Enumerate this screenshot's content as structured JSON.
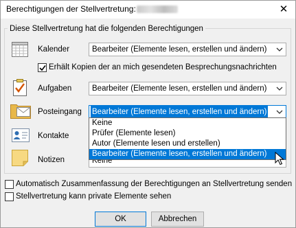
{
  "window": {
    "title": "Berechtigungen der Stellvertretung:",
    "close_glyph": "✕"
  },
  "group": {
    "caption": "Diese Stellvertretung hat die folgenden Berechtigungen"
  },
  "rows": {
    "kalender": {
      "label": "Kalender",
      "value": "Bearbeiter (Elemente lesen, erstellen und ändern)",
      "icon": "calendar-icon"
    },
    "aufgaben": {
      "label": "Aufgaben",
      "value": "Bearbeiter (Elemente lesen, erstellen und ändern)",
      "icon": "tasks-icon"
    },
    "posteingang": {
      "label": "Posteingang",
      "value": "Bearbeiter (Elemente lesen, erstellen und ändern)",
      "icon": "inbox-icon"
    },
    "kontakte": {
      "label": "Kontakte",
      "icon": "contacts-icon"
    },
    "notizen": {
      "label": "Notizen",
      "value": "Keine",
      "icon": "notes-icon"
    }
  },
  "meeting_copies": {
    "label": "Erhält Kopien der an mich gesendeten Besprechungsnachrichten",
    "checked": true
  },
  "dropdown": {
    "options": [
      "Keine",
      "Prüfer (Elemente lesen)",
      "Autor (Elemente lesen und erstellen)",
      "Bearbeiter (Elemente lesen, erstellen und ändern)"
    ],
    "selected_index": 3
  },
  "bottom_checks": {
    "auto_summary": {
      "label": "Automatisch Zusammenfassung der Berechtigungen an Stellvertretung senden",
      "checked": false
    },
    "private_items": {
      "label": "Stellvertretung kann private Elemente sehen",
      "checked": false
    }
  },
  "buttons": {
    "ok": "OK",
    "cancel": "Abbrechen"
  },
  "colors": {
    "accent": "#0078d7",
    "window_bg": "#f0f0f0"
  }
}
